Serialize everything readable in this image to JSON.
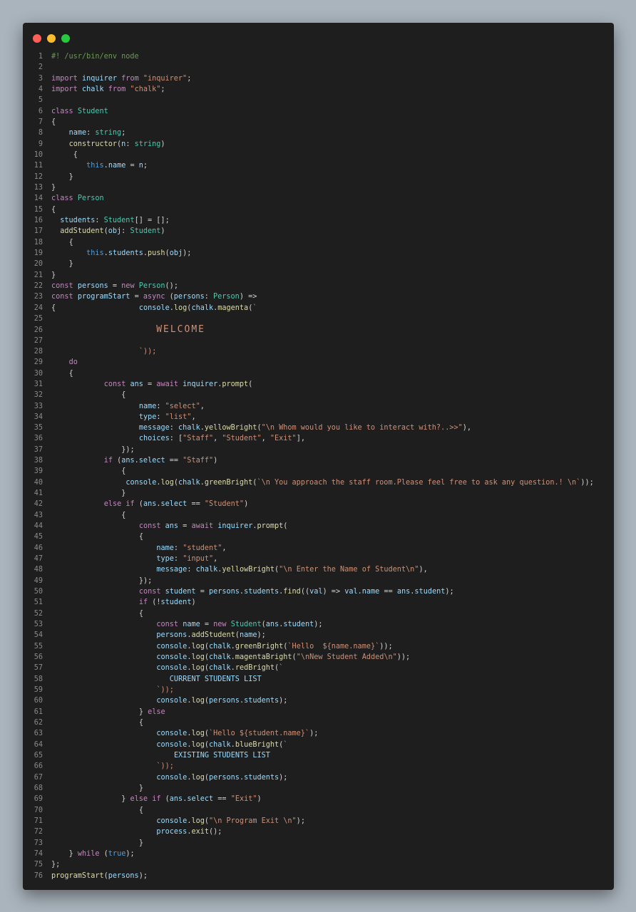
{
  "lines": [
    "#! /usr/bin/env node",
    "",
    "import inquirer from \"inquirer\";",
    "import chalk from \"chalk\";",
    "",
    "class Student",
    "{",
    "    name: string;",
    "    constructor(n: string)",
    "     {",
    "        this.name = n;",
    "    }",
    "}",
    "class Person",
    "{",
    "  students: Student[] = [];",
    "  addStudent(obj: Student)",
    "    {",
    "        this.students.push(obj);",
    "    }",
    "}",
    "const persons = new Person();",
    "const programStart = async (persons: Person) =>",
    "{                   console.log(chalk.magenta(`",
    "",
    "                        WELCOME",
    "",
    "                    `));",
    "    do",
    "    {",
    "            const ans = await inquirer.prompt(",
    "                {",
    "                    name: \"select\",",
    "                    type: \"list\",",
    "                    message: chalk.yellowBright(\"\\n Whom would you like to interact with?..>>\"),",
    "                    choices: [\"Staff\", \"Student\", \"Exit\"],",
    "                });",
    "            if (ans.select == \"Staff\")",
    "                {",
    "                 console.log(chalk.greenBright(`\\n You approach the staff room.Please feel free to ask any question.! \\n`));",
    "                }",
    "            else if (ans.select == \"Student\")",
    "                {",
    "                    const ans = await inquirer.prompt(",
    "                    {",
    "                        name: \"student\",",
    "                        type: \"input\",",
    "                        message: chalk.yellowBright(\"\\n Enter the Name of Student\\n\"),",
    "                    });",
    "                    const student = persons.students.find((val) => val.name == ans.student);",
    "                    if (!student)",
    "                    {",
    "                        const name = new Student(ans.student);",
    "                        persons.addStudent(name);",
    "                        console.log(chalk.greenBright(`Hello  ${name.name}`));",
    "                        console.log(chalk.magentaBright(\"\\nNew Student Added\\n\"));",
    "                        console.log(chalk.redBright(`",
    "                           CURRENT STUDENTS LIST",
    "                        `));",
    "                        console.log(persons.students);",
    "                    } else",
    "                    {",
    "                        console.log(`Hello ${student.name}`);",
    "                        console.log(chalk.blueBright(`",
    "                            EXISTING STUDENTS LIST",
    "                        `));",
    "                        console.log(persons.students);",
    "                    }",
    "                } else if (ans.select == \"Exit\")",
    "                    {",
    "                        console.log(\"\\n Program Exit \\n\");",
    "                        process.exit();",
    "                    }",
    "    } while (true);",
    "};",
    "programStart(persons);"
  ]
}
